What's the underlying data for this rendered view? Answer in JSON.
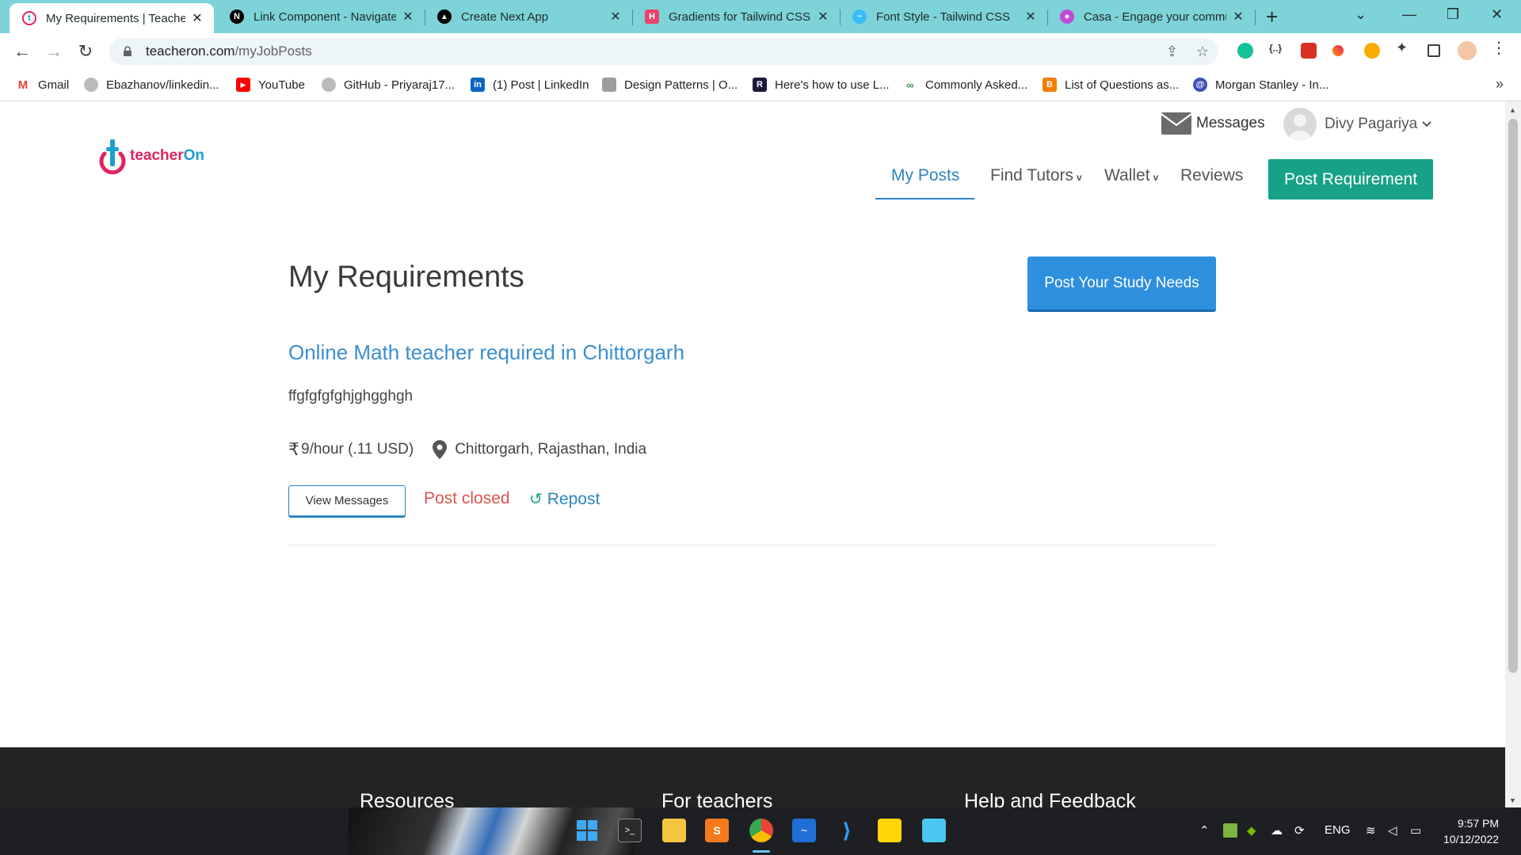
{
  "browser": {
    "tabs": [
      {
        "title": "My Requirements | TeacherOn",
        "icon": "teacheron-favicon",
        "active": true
      },
      {
        "title": "Link Component - Navigate",
        "icon": "nextjs-favicon"
      },
      {
        "title": "Create Next App",
        "icon": "vercel-favicon"
      },
      {
        "title": "Gradients for Tailwind CSS |",
        "icon": "hyperui-favicon"
      },
      {
        "title": "Font Style - Tailwind CSS",
        "icon": "tailwind-favicon"
      },
      {
        "title": "Casa - Engage your commu",
        "icon": "casa-favicon"
      }
    ],
    "url_host": "teacheron.com",
    "url_path": "/myJobPosts",
    "bookmarks": [
      {
        "label": "Gmail",
        "icon": "gmail-icon"
      },
      {
        "label": "Ebazhanov/linkedin...",
        "icon": "github-icon"
      },
      {
        "label": "YouTube",
        "icon": "youtube-icon"
      },
      {
        "label": "GitHub - Priyaraj17...",
        "icon": "github-icon"
      },
      {
        "label": "(1) Post | LinkedIn",
        "icon": "linkedin-icon"
      },
      {
        "label": "Design Patterns | O...",
        "icon": "oodesign-icon"
      },
      {
        "label": "Here's how to use L...",
        "icon": "r-icon"
      },
      {
        "label": "Commonly Asked...",
        "icon": "gfg-icon"
      },
      {
        "label": "List of Questions as...",
        "icon": "blogger-icon"
      },
      {
        "label": "Morgan Stanley - In...",
        "icon": "at-icon"
      }
    ],
    "bookmarks_more": "»"
  },
  "site": {
    "logo_text_main": "teacher",
    "logo_text_accent": "On",
    "messages_label": "Messages",
    "user_name": "Divy Pagariya",
    "nav": [
      {
        "label": "My Posts",
        "active": true
      },
      {
        "label": "Find Tutors",
        "dropdown": true
      },
      {
        "label": "Wallet",
        "dropdown": true
      },
      {
        "label": "Reviews"
      }
    ],
    "nav_caret": "v",
    "post_requirement_label": "Post Requirement",
    "colors": {
      "brand_green": "#17a186",
      "link_blue": "#2c84c4",
      "closed_red": "#d9534f"
    }
  },
  "main": {
    "title": "My Requirements",
    "study_needs_label": "Post Your Study Needs",
    "job": {
      "title": "Online Math teacher required in Chittorgarh",
      "description": "ffgfgfgfghjghgghgh",
      "rupee_symbol": "₹",
      "rate": "9/hour (.11 USD)",
      "location": "Chittorgarh, Rajasthan, India",
      "view_messages_label": "View Messages",
      "status": "Post closed",
      "repost_label": "Repost"
    }
  },
  "footer": {
    "columns": [
      "Resources",
      "For teachers",
      "Help and Feedback"
    ]
  },
  "taskbar": {
    "language": "ENG",
    "time": "9:57 PM",
    "date": "10/12/2022"
  }
}
